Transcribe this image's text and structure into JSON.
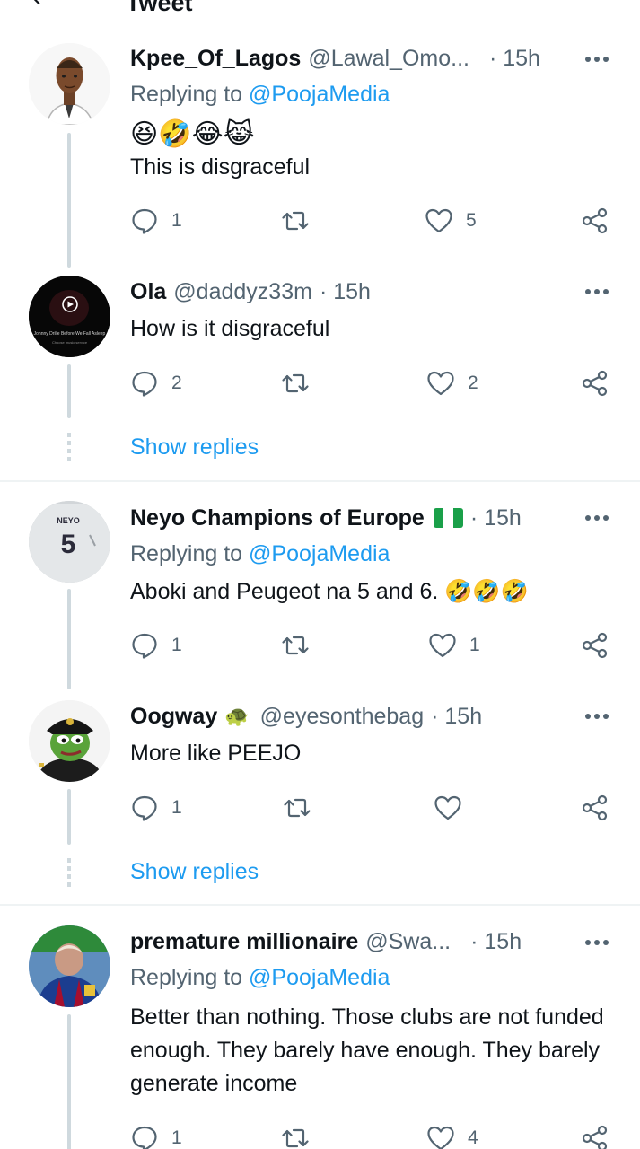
{
  "header": {
    "title": "Tweet"
  },
  "tweets": [
    {
      "name": "Kpee_Of_Lagos",
      "handle": "@Lawal_Omo...",
      "time": "· 15h",
      "reply_prefix": "Replying to ",
      "reply_to": "@PoojaMedia",
      "emojis": "😆🤣😂😹",
      "text": "This is disgraceful",
      "reply_count": "1",
      "retweet_count": "",
      "like_count": "5"
    },
    {
      "name": "Ola",
      "handle": "@daddyz33m",
      "time": "· 15h",
      "text": "How is it disgraceful",
      "reply_count": "2",
      "retweet_count": "",
      "like_count": "2",
      "avatar_caption": "Johnny Drille Before We Fall Asleep",
      "avatar_subcaption": "Choose music service"
    },
    {
      "name": "Neyo Champions of Europe",
      "handle": "",
      "time": "· 15h",
      "reply_prefix": "Replying to ",
      "reply_to": "@PoojaMedia",
      "text": "Aboki and Peugeot na 5 and 6. 🤣🤣🤣",
      "reply_count": "1",
      "retweet_count": "",
      "like_count": "1",
      "jersey_name": "NEYO",
      "jersey_number": "5"
    },
    {
      "name": "Oogway",
      "name_emoji": "🐢",
      "handle": "@eyesonthebag",
      "time": "· 15h",
      "text": "More like PEEJO",
      "reply_count": "1",
      "retweet_count": "",
      "like_count": ""
    },
    {
      "name": "premature millionaire",
      "handle": "@Swa...",
      "time": "· 15h",
      "reply_prefix": "Replying to ",
      "reply_to": "@PoojaMedia",
      "text": "Better than nothing. Those clubs are not funded enough. They barely have enough. They barely generate income",
      "reply_count": "1",
      "retweet_count": "",
      "like_count": "4"
    }
  ],
  "show_replies_label": "Show replies",
  "colors": {
    "accent": "#1d9bf0",
    "secondary_text": "#536471",
    "thread_line": "#cfd9de",
    "divider": "#eff3f4"
  }
}
